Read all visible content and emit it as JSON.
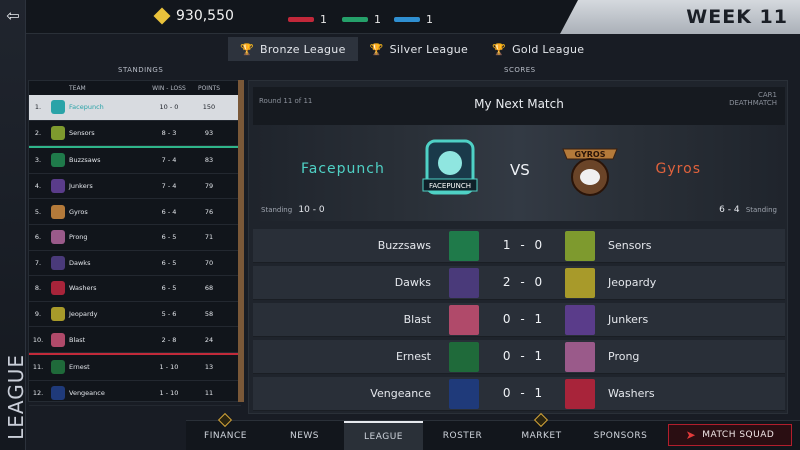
{
  "topbar": {
    "back_icon": "back-arrow-icon",
    "coins": "930,550",
    "tokens": [
      {
        "color": "#c2283a",
        "count": "1"
      },
      {
        "color": "#25a06a",
        "count": "1"
      },
      {
        "color": "#2f8fd1",
        "count": "1"
      }
    ],
    "week": "WEEK 11"
  },
  "side_label": "LEAGUE",
  "league_tabs": [
    {
      "label": "Bronze League",
      "active": true,
      "color": "#c98b4a"
    },
    {
      "label": "Silver League",
      "active": false,
      "color": "#cfd3d8"
    },
    {
      "label": "Gold League",
      "active": false,
      "color": "#e0b23a"
    }
  ],
  "standings": {
    "section_title": "STANDINGS",
    "headers": {
      "team": "TEAM",
      "wl": "WIN - LOSS",
      "pts": "POINTS"
    },
    "rows": [
      {
        "rank": "1.",
        "team": "Facepunch",
        "wl": "10 - 0",
        "pts": "150",
        "color": "#2aa3a8"
      },
      {
        "rank": "2.",
        "team": "Sensors",
        "wl": "8 - 3",
        "pts": "93",
        "color": "#7e9a2e"
      },
      {
        "rank": "3.",
        "team": "Buzzsaws",
        "wl": "7 - 4",
        "pts": "83",
        "color": "#1f7a4a"
      },
      {
        "rank": "4.",
        "team": "Junkers",
        "wl": "7 - 4",
        "pts": "79",
        "color": "#5a3c8a"
      },
      {
        "rank": "5.",
        "team": "Gyros",
        "wl": "6 - 4",
        "pts": "76",
        "color": "#b47a3a"
      },
      {
        "rank": "6.",
        "team": "Prong",
        "wl": "6 - 5",
        "pts": "71",
        "color": "#9a5a8a"
      },
      {
        "rank": "7.",
        "team": "Dawks",
        "wl": "6 - 5",
        "pts": "70",
        "color": "#4a3a7a"
      },
      {
        "rank": "8.",
        "team": "Washers",
        "wl": "6 - 5",
        "pts": "68",
        "color": "#a8243a"
      },
      {
        "rank": "9.",
        "team": "Jeopardy",
        "wl": "5 - 6",
        "pts": "58",
        "color": "#a89a2a"
      },
      {
        "rank": "10.",
        "team": "Blast",
        "wl": "2 - 8",
        "pts": "24",
        "color": "#b04a6a"
      },
      {
        "rank": "11.",
        "team": "Ernest",
        "wl": "1 - 10",
        "pts": "13",
        "color": "#1f6a3a"
      },
      {
        "rank": "12.",
        "team": "Vengeance",
        "wl": "1 - 10",
        "pts": "11",
        "color": "#1f3a7a"
      }
    ]
  },
  "scores": {
    "section_title": "SCORES",
    "next_match": {
      "round_text": "Round 11 of 11",
      "title": "My Next Match",
      "car": "CAR1",
      "mode": "DEATHMATCH",
      "home": "Facepunch",
      "away": "Gyros",
      "vs": "VS",
      "home_badge": "FACEPUNCH",
      "away_badge": "GYROS",
      "standing_label": "Standing",
      "home_standing": "10 - 0",
      "away_standing": "6 - 4"
    },
    "results": [
      {
        "home": "Buzzsaws",
        "score": "1 - 0",
        "away": "Sensors",
        "home_color": "#1f7a4a",
        "away_color": "#7e9a2e"
      },
      {
        "home": "Dawks",
        "score": "2 - 0",
        "away": "Jeopardy",
        "home_color": "#4a3a7a",
        "away_color": "#a89a2a"
      },
      {
        "home": "Blast",
        "score": "0 - 1",
        "away": "Junkers",
        "home_color": "#b04a6a",
        "away_color": "#5a3c8a"
      },
      {
        "home": "Ernest",
        "score": "0 - 1",
        "away": "Prong",
        "home_color": "#1f6a3a",
        "away_color": "#9a5a8a"
      },
      {
        "home": "Vengeance",
        "score": "0 - 1",
        "away": "Washers",
        "home_color": "#1f3a7a",
        "away_color": "#a8243a"
      }
    ]
  },
  "bottom_nav": {
    "items": [
      {
        "label": "FINANCE",
        "alert": true,
        "active": false
      },
      {
        "label": "NEWS",
        "alert": false,
        "active": false
      },
      {
        "label": "LEAGUE",
        "alert": false,
        "active": true
      },
      {
        "label": "ROSTER",
        "alert": false,
        "active": false
      },
      {
        "label": "MARKET",
        "alert": true,
        "active": false
      },
      {
        "label": "SPONSORS",
        "alert": false,
        "active": false
      }
    ],
    "match_squad": "MATCH SQUAD"
  }
}
